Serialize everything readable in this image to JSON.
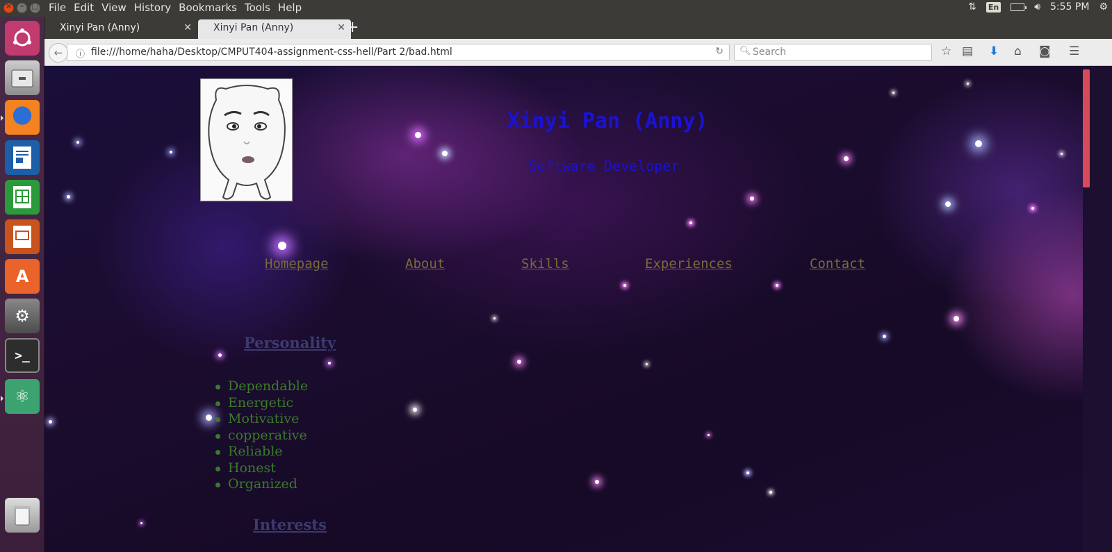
{
  "menubar": {
    "items": [
      "File",
      "Edit",
      "View",
      "History",
      "Bookmarks",
      "Tools",
      "Help"
    ],
    "keyboard_layout": "En",
    "clock": "5:55 PM"
  },
  "launcher": {
    "apps": [
      "Ubuntu dash",
      "Files",
      "Firefox",
      "LibreOffice Writer",
      "LibreOffice Calc",
      "LibreOffice Impress",
      "Ubuntu Software",
      "System Settings",
      "Terminal",
      "Atom",
      "Trash"
    ]
  },
  "browser": {
    "tabs": [
      {
        "title": "Xinyi Pan (Anny)",
        "active": false
      },
      {
        "title": "Xinyi Pan (Anny)",
        "active": true
      }
    ],
    "url": "file:///home/haha/Desktop/CMPUT404-assignment-css-hell/Part 2/bad.html",
    "search_placeholder": "Search"
  },
  "page": {
    "name": "Xinyi Pan (Anny)",
    "role": "Software Developer",
    "nav": [
      "Homepage",
      "About",
      "Skills",
      "Experiences",
      "Contact"
    ],
    "personality_title": "Personality",
    "personality": [
      "Dependable",
      "Energetic",
      "Motivative",
      "copperative",
      "Reliable",
      "Honest",
      "Organized"
    ],
    "interests_title": "Interests"
  },
  "colors": {
    "title_blue": "#1a12d4",
    "nav_link": "#7a6a3c",
    "list_green": "#3a7a2a",
    "section_heading": "#3c3a70"
  }
}
